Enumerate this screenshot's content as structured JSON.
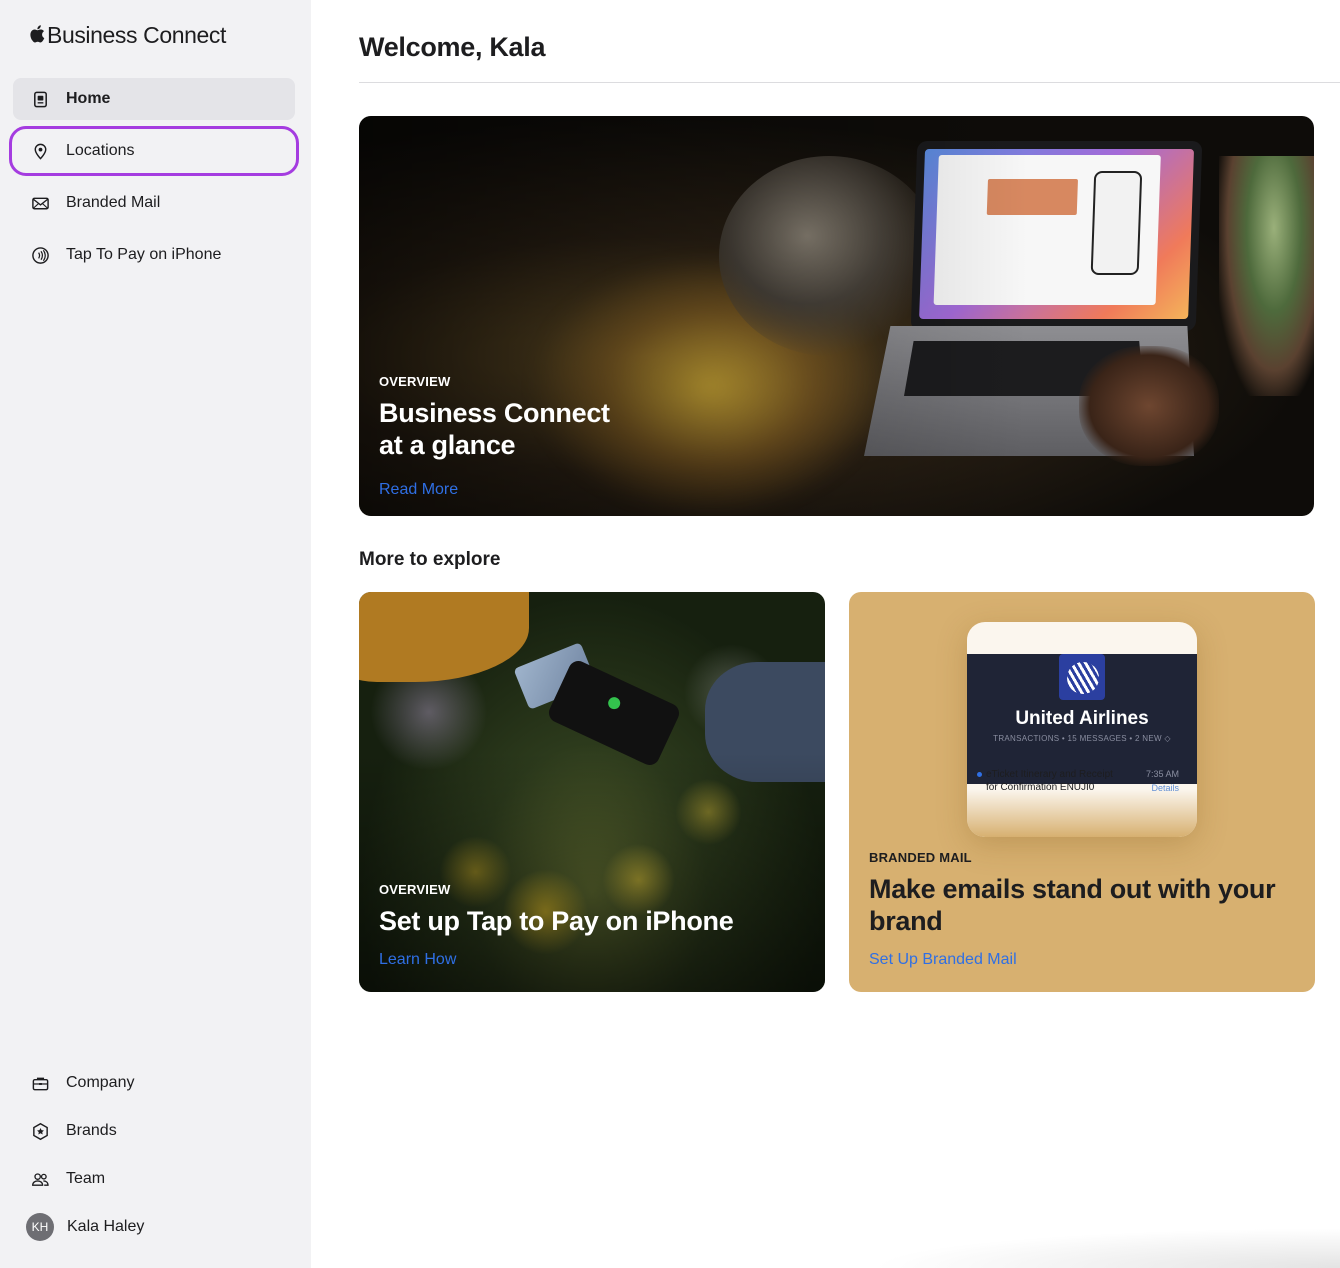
{
  "app": {
    "brand_name": "Business Connect",
    "brand_icon": "apple-logo-icon"
  },
  "sidebar": {
    "items": [
      {
        "label": "Home",
        "icon": "home-icon",
        "active": true
      },
      {
        "label": "Locations",
        "icon": "location-pin-icon",
        "focused": true
      },
      {
        "label": "Branded Mail",
        "icon": "envelope-icon"
      },
      {
        "label": "Tap To Pay on iPhone",
        "icon": "contactless-icon"
      }
    ],
    "bottom_items": [
      {
        "label": "Company",
        "icon": "briefcase-icon"
      },
      {
        "label": "Brands",
        "icon": "star-badge-icon"
      },
      {
        "label": "Team",
        "icon": "people-icon"
      }
    ],
    "user": {
      "initials": "KH",
      "name": "Kala Haley"
    }
  },
  "main": {
    "welcome": "Welcome, Kala",
    "hero": {
      "eyebrow": "OVERVIEW",
      "title_line1": "Business Connect",
      "title_line2": "at a glance",
      "link": "Read More"
    },
    "section_title": "More to explore",
    "cards": [
      {
        "eyebrow": "OVERVIEW",
        "title": "Set up Tap to Pay on iPhone",
        "link": "Learn How"
      },
      {
        "eyebrow": "BRANDED MAIL",
        "title_line1": "Make emails stand out with your",
        "title_line2": "brand",
        "link": "Set Up Branded Mail",
        "mock": {
          "airline": "United Airlines",
          "meta": "TRANSACTIONS • 15 MESSAGES • 2 NEW ◇",
          "subject_line1": "eTicket Itinerary and Receipt",
          "subject_line2": "for Confirmation ENUJI0",
          "time": "7:35 AM",
          "details": "Details"
        }
      }
    ]
  },
  "colors": {
    "sidebar_bg": "#f2f2f4",
    "active_bg": "#e4e4e8",
    "focus_ring": "#a53ce0",
    "link": "#2f6fe4",
    "mail_card_bg": "#d7b070"
  }
}
